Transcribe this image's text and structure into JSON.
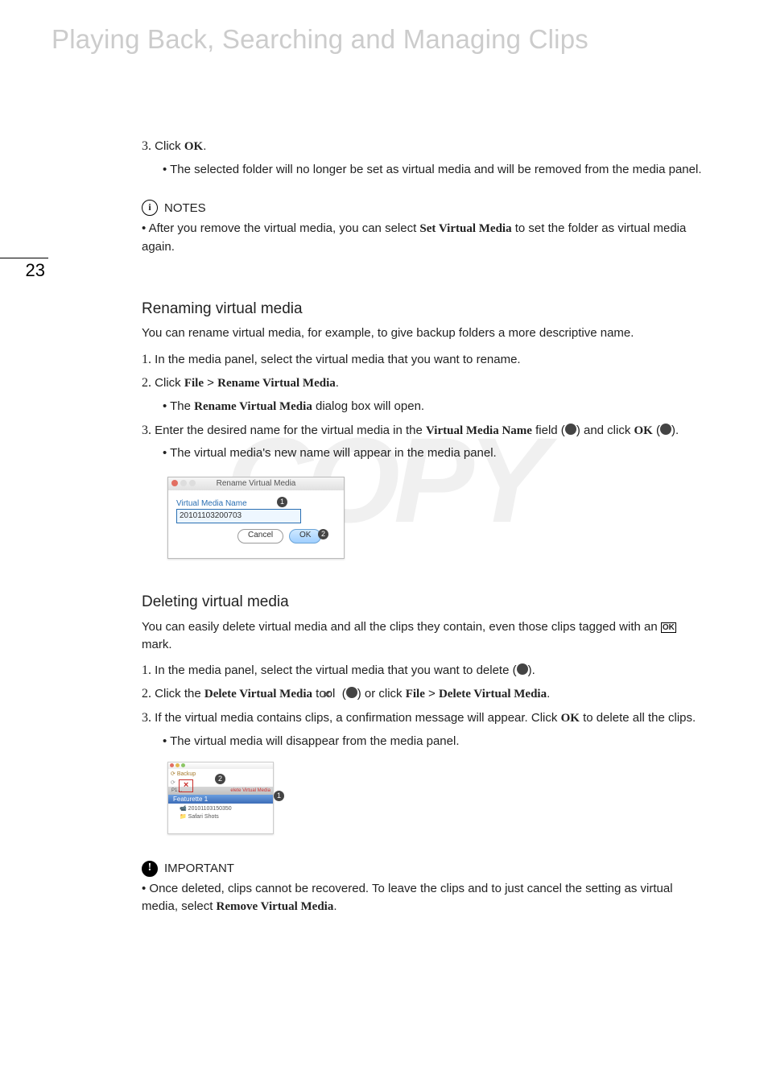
{
  "header": {
    "title": "Playing Back, Searching and Managing Clips",
    "page_number": "23"
  },
  "watermark": "COPY",
  "section1": {
    "step3_num": "3.",
    "step3_click": "Click ",
    "step3_ok": "OK",
    "step3_period": ".",
    "bullet": "• The selected folder will no longer be set as virtual media and will be removed from the media panel."
  },
  "notes": {
    "label": "NOTES",
    "bullet_pre": "• After you remove the virtual media, you can select ",
    "bullet_bold": "Set Virtual Media",
    "bullet_post": " to set the folder as virtual media again."
  },
  "rename": {
    "heading": "Renaming virtual media",
    "intro": "You can rename virtual media, for example, to give backup folders a more descriptive name.",
    "s1_num": "1.",
    "s1": "In the media panel, select the virtual media that you want to rename.",
    "s2_num": "2.",
    "s2_click": "Click ",
    "s2_file": "File",
    "s2_gt": " > ",
    "s2_cmd": "Rename Virtual Media",
    "s2_period": ".",
    "s2_bullet_pre": "• The ",
    "s2_bullet_bold": "Rename Virtual Media",
    "s2_bullet_post": " dialog box will open.",
    "s3_num": "3.",
    "s3_pre": "Enter the desired name for the virtual media in the ",
    "s3_bold": "Virtual Media Name",
    "s3_mid": " field (",
    "s3_mid2": ") and click ",
    "s3_ok": "OK",
    "s3_paren_open": " (",
    "s3_paren_close": ").",
    "s3_bullet": "• The virtual media's new name will appear in the media panel.",
    "dialog": {
      "title": "Rename Virtual Media",
      "label": "Virtual Media Name",
      "value": "20101103200703",
      "cancel": "Cancel",
      "ok": "OK"
    }
  },
  "delete": {
    "heading": "Deleting virtual media",
    "intro_pre": "You can easily delete virtual media and all the clips they contain, even those clips tagged with an ",
    "intro_sym": "OK",
    "intro_post": " mark.",
    "s1_num": "1.",
    "s1_pre": "In the media panel, select the virtual media that you want to delete (",
    "s1_post": ").",
    "s2_num": "2.",
    "s2_pre": "Click the ",
    "s2_bold1": "Delete Virtual Media",
    "s2_mid1": " tool ",
    "s2_paren_open": " (",
    "s2_mid2": ") or click ",
    "s2_file": "File",
    "s2_gt": " > ",
    "s2_bold2": "Delete Virtual Media",
    "s2_period": ".",
    "s3_num": "3.",
    "s3_pre": "If the virtual media contains clips, a confirmation message will appear. Click ",
    "s3_ok": "OK",
    "s3_post": " to delete all the clips.",
    "s3_bullet": "• The virtual media will disappear from the media panel.",
    "fig": {
      "tool_label": "Backup",
      "tooltip": "elete Virtual Media",
      "tab": "P1…",
      "row_head": "Featurette 1",
      "entry1": "20101103150350",
      "entry2": "Safari Shots"
    }
  },
  "important": {
    "label": "IMPORTANT",
    "bullet_pre": "• Once deleted, clips cannot be recovered. To leave the clips and to just cancel the setting as virtual media, select ",
    "bullet_bold": "Remove Virtual Media",
    "bullet_post": "."
  }
}
